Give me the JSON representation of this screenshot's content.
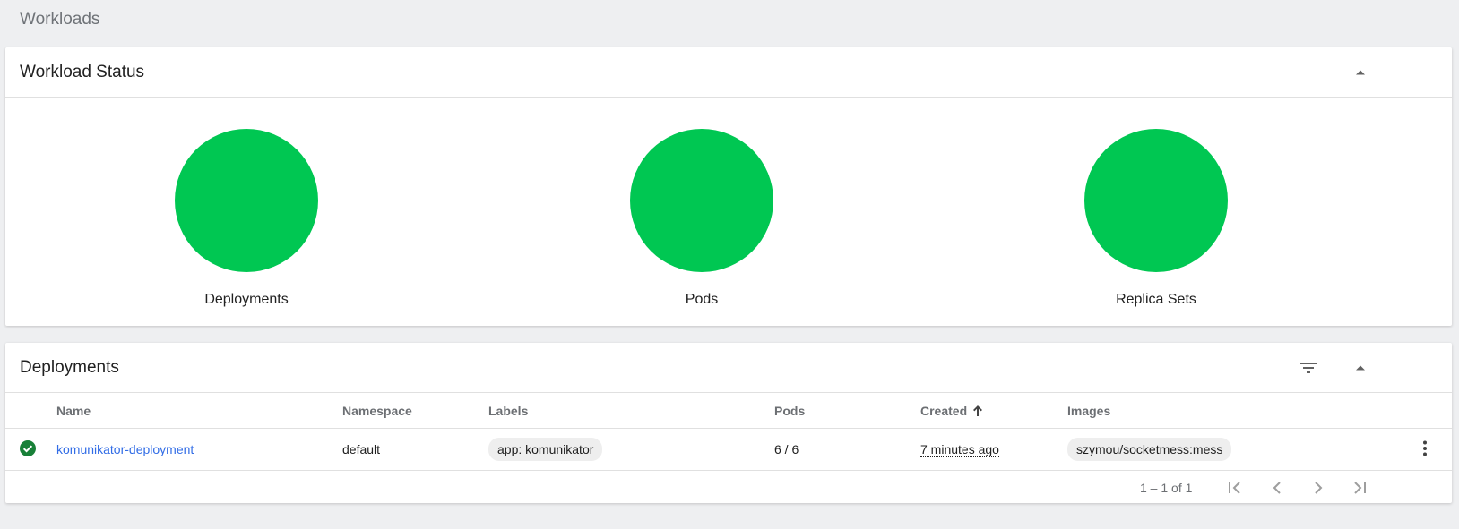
{
  "page": {
    "title": "Workloads"
  },
  "workload_status": {
    "title": "Workload Status",
    "status_color": "#00c752",
    "items": [
      {
        "label": "Deployments"
      },
      {
        "label": "Pods"
      },
      {
        "label": "Replica Sets"
      }
    ]
  },
  "deployments": {
    "title": "Deployments",
    "columns": {
      "name": "Name",
      "namespace": "Namespace",
      "labels": "Labels",
      "pods": "Pods",
      "created": "Created",
      "images": "Images"
    },
    "sort": {
      "column": "Created",
      "direction": "ascending",
      "icon": "arrow-up-icon"
    },
    "rows": [
      {
        "status": "running",
        "status_icon": "check-circle-icon",
        "status_color": "#188038",
        "name": "komunikator-deployment",
        "namespace": "default",
        "labels": [
          "app: komunikator"
        ],
        "pods": "6 / 6",
        "created": "7 minutes ago",
        "images": [
          "szymou/socketmess:mess"
        ]
      }
    ],
    "paginator": {
      "range": "1 – 1 of 1"
    }
  },
  "colors": {
    "accent": "#326de6",
    "success": "#00c752",
    "background": "#eeeff1"
  }
}
